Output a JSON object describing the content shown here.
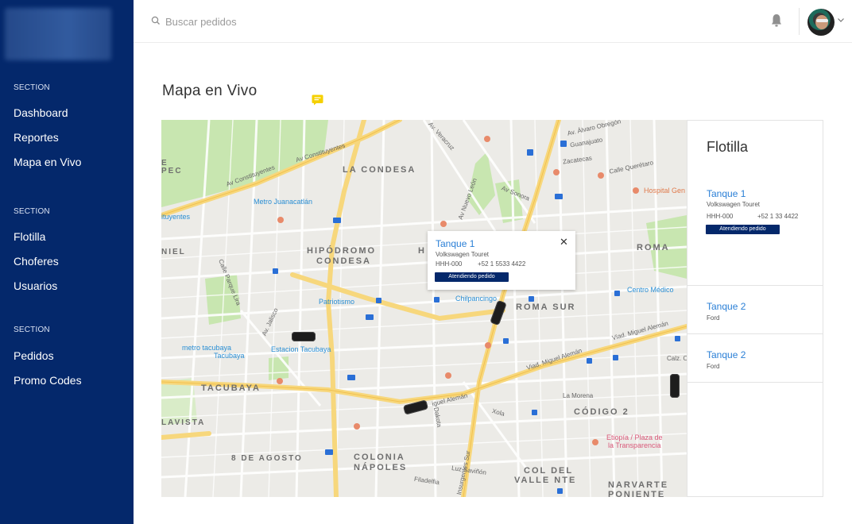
{
  "sidebar": {
    "sections": [
      {
        "title": "SECTION",
        "items": [
          "Dashboard",
          "Reportes",
          "Mapa en Vivo"
        ]
      },
      {
        "title": "SECTION",
        "items": [
          "Flotilla",
          "Choferes",
          "Usuarios"
        ]
      },
      {
        "title": "SECTION",
        "items": [
          "Pedidos",
          "Promo Codes"
        ]
      }
    ]
  },
  "header": {
    "search_placeholder": "Buscar pedidos"
  },
  "page": {
    "title": "Mapa en Vivo"
  },
  "map": {
    "labels": {
      "la_condesa": "LA CONDESA",
      "hipodromo": "HIPÓDROMO",
      "condesa": "CONDESA",
      "roma_sur": "ROMA SUR",
      "roma": "ROMA",
      "tacubaya": "TACUBAYA",
      "codigo2": "CÓDIGO 2",
      "colonia": "COLONIA",
      "napoles": "NÁPOLES",
      "col_del": "COL DEL",
      "valle_nte": "VALLE NTE",
      "narvarte": "NARVARTE",
      "poniente": "PONIENTE",
      "ocho_agosto": "8 DE AGOSTO",
      "lavista": "LAVISTA",
      "niel": "NIEL",
      "ec": "E",
      "pec": "PEC",
      "h": "H"
    },
    "streets": {
      "constituyentes1": "Av Constituyentes",
      "constituyentes2": "Av Constituyentes",
      "veracruz": "Av. Veracruz",
      "nuevo_leon": "Av Nuevo León",
      "sonora": "Av Sonora",
      "alvaro": "Av. Álvaro Obregón",
      "guanajuato": "Guanajuato",
      "zacatecas": "Zacatecas",
      "queretaro": "Calle Querétaro",
      "miguel_aleman1": "Viad. Miguel Alemán",
      "miguel_aleman2": "Viad. Miguel Alemán",
      "miguel_aleman3": "iguel Alemán",
      "la_morena": "La Morena",
      "xola": "Xola",
      "luz_savinon": "Luz Saviñón",
      "filadelfia": "Filadelfia",
      "insurgentes": "Insurgentes Sur",
      "jalisco": "Av. Jalisco",
      "parque_lira": "Calle Parque Lira",
      "dakota": "Dakota",
      "calz": "Calz. O"
    },
    "places": {
      "metro_juanacatlan": "Metro Juanacatlán",
      "patriotismo": "Patriotismo",
      "chilpancingo": "Chilpancingo",
      "metro_tacubaya": "metro tacubaya",
      "tacubaya": "Tacubaya",
      "estacion_tacubaya": "Estacion Tacubaya",
      "hospital": "Hospital Gen",
      "centro_medico": "Centro Médico",
      "etiopia": "Etiopía / Plaza de",
      "transparencia": "la Transparencia",
      "ituyentes": "ituyentes"
    },
    "popup": {
      "name": "Tanque 1",
      "model": "Volkswagen Touret",
      "plate": "HHH-000",
      "phone": "+52 1 5533 4422",
      "status": "Atendiendo pedido",
      "close": "✕"
    }
  },
  "fleet": {
    "title": "Flotilla",
    "vehicles": [
      {
        "name": "Tanque 1",
        "model": "Volkswagen Touret",
        "plate": "HHH-000",
        "phone": "+52 1 33 4422",
        "status": "Atendiendo pedido"
      },
      {
        "name": "Tanque 2",
        "model": "Ford"
      },
      {
        "name": "Tanque 2",
        "model": "Ford"
      }
    ]
  },
  "colors": {
    "sidebar_bg": "#04286b",
    "accent_blue": "#2a7fd6",
    "status_bg": "#04286b",
    "map_bg": "#ecebe7",
    "park_green": "#c8e6b0",
    "highway_yellow": "#f7d77c"
  }
}
